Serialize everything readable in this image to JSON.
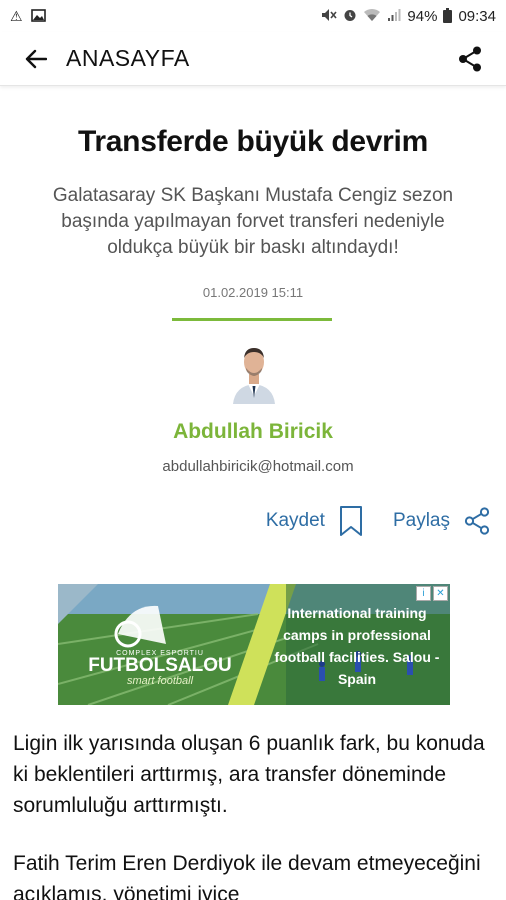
{
  "status_bar": {
    "battery": "94%",
    "time": "09:34"
  },
  "app_bar": {
    "title": "ANASAYFA"
  },
  "article": {
    "headline": "Transferde büyük devrim",
    "subtitle": "Galatasaray SK Başkanı Mustafa Cengiz sezon başında yapılmayan forvet transferi nedeniyle oldukça büyük bir baskı altındaydı!",
    "date": "01.02.2019 15:11",
    "author_name": "Abdullah Biricik",
    "author_email": "abdullahbiricik@hotmail.com",
    "save_label": "Kaydet",
    "share_label": "Paylaş",
    "paragraphs": [
      "Ligin ilk yarısında oluşan 6 puanlık fark, bu konuda ki beklentileri arttırmış, ara transfer döneminde sorumluluğu arttırmıştı.",
      "Fatih Terim Eren Derdiyok ile devam etmeyeceğini açıklamış, yönetimi iyice"
    ]
  },
  "ad": {
    "headline": "International training camps in professional football facilities. Salou - Spain",
    "brand_small": "COMPLEX ESPORTIU",
    "brand_name": "FUTBOLSALOU",
    "brand_tag": "smart football"
  },
  "colors": {
    "accent_green": "#7cb53a",
    "link_blue": "#2e6da4"
  },
  "icons": [
    "back-arrow-icon",
    "share-icon",
    "bookmark-icon",
    "ad-info-icon",
    "ad-close-icon"
  ]
}
